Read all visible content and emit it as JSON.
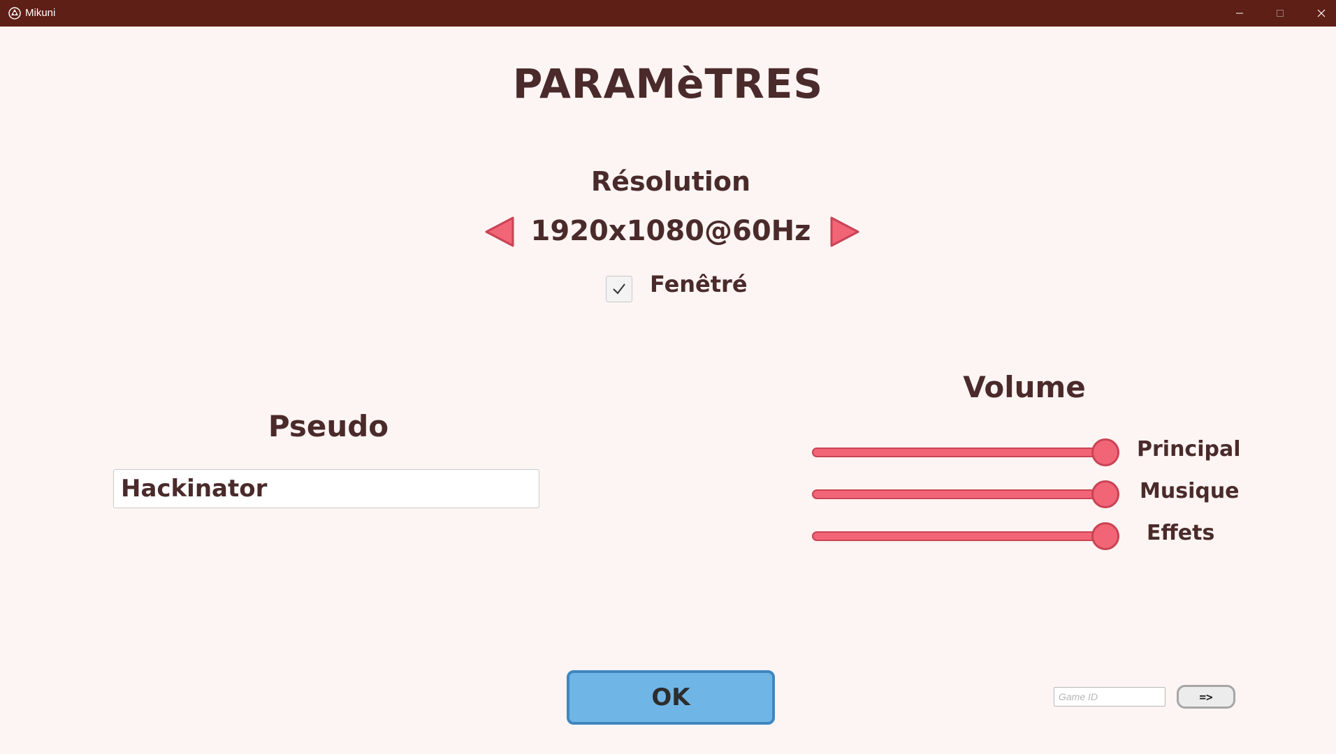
{
  "window": {
    "title": "Mikuni",
    "title_bar_color": "#5e1f16",
    "icons": [
      "unity-icon",
      "minimize-icon",
      "maximize-icon",
      "close-icon"
    ]
  },
  "page": {
    "title": "PARAMèTRES"
  },
  "resolution": {
    "title": "Résolution",
    "value": "1920x1080@60Hz",
    "prev_icon": "arrow-left-icon",
    "next_icon": "arrow-right-icon",
    "windowed_label": "Fenêtré",
    "windowed_checked": true
  },
  "pseudo": {
    "title": "Pseudo",
    "value": "Hackinator"
  },
  "volume": {
    "title": "Volume",
    "sliders": [
      {
        "label": "Principal",
        "level": 1.0
      },
      {
        "label": "Musique",
        "level": 1.0
      },
      {
        "label": "Effets",
        "level": 1.0
      }
    ]
  },
  "actions": {
    "ok_label": "OK",
    "game_id_placeholder": "Game ID",
    "go_label": "=>"
  },
  "colors": {
    "background": "#fdf5f3",
    "text": "#4a2a2a",
    "accent_red": "#f26577",
    "ok_blue": "#6fb6e6"
  }
}
